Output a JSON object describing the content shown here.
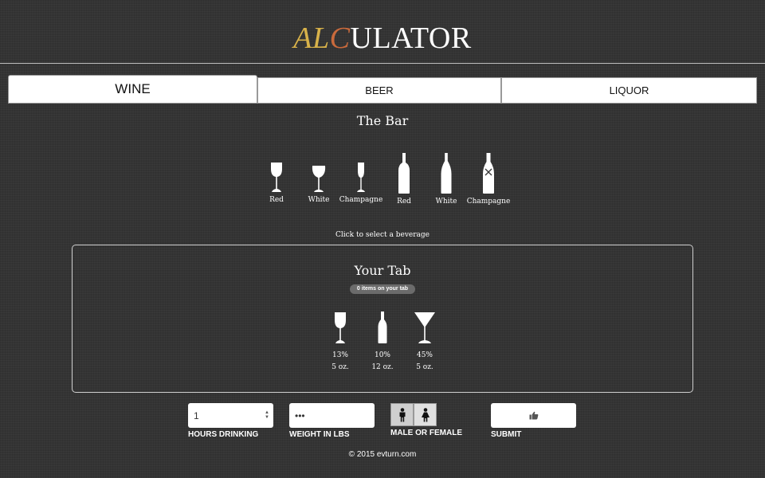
{
  "header": {
    "logo_part1": "AL",
    "logo_part2": "C",
    "logo_part3": "ULATOR"
  },
  "tabs": [
    {
      "label": "WINE",
      "active": true
    },
    {
      "label": "BEER",
      "active": false
    },
    {
      "label": "LIQUOR",
      "active": false
    }
  ],
  "bar": {
    "title": "The Bar",
    "beverages": [
      {
        "label": "Red",
        "icon": "red-wine-glass-icon"
      },
      {
        "label": "White",
        "icon": "white-wine-glass-icon"
      },
      {
        "label": "Champagne",
        "icon": "champagne-flute-icon"
      },
      {
        "label": "Red",
        "icon": "red-wine-bottle-icon"
      },
      {
        "label": "White",
        "icon": "white-wine-bottle-icon"
      },
      {
        "label": "Champagne",
        "icon": "champagne-bottle-icon"
      }
    ],
    "hint": "Click to select a beverage"
  },
  "your_tab": {
    "title": "Your Tab",
    "count": "0 items on your tab",
    "drinks": [
      {
        "icon": "wine-glass-icon",
        "percent": "13%",
        "size": "5 oz."
      },
      {
        "icon": "beer-bottle-icon",
        "percent": "10%",
        "size": "12 oz."
      },
      {
        "icon": "martini-glass-icon",
        "percent": "45%",
        "size": "5 oz."
      }
    ]
  },
  "form": {
    "hours_value": "1",
    "hours_label": "HOURS DRINKING",
    "weight_placeholder": "•••",
    "weight_label": "WEIGHT IN LBS",
    "gender_label": "MALE OR FEMALE",
    "male_icon": "male-icon",
    "female_icon": "female-icon",
    "submit_label": "SUBMIT",
    "submit_icon": "thumbs-up-icon"
  },
  "footer": "© 2015 evturn.com",
  "colors": {
    "logo_gold": "#d8b24a",
    "logo_copper": "#c96a3c",
    "background": "#343434"
  }
}
